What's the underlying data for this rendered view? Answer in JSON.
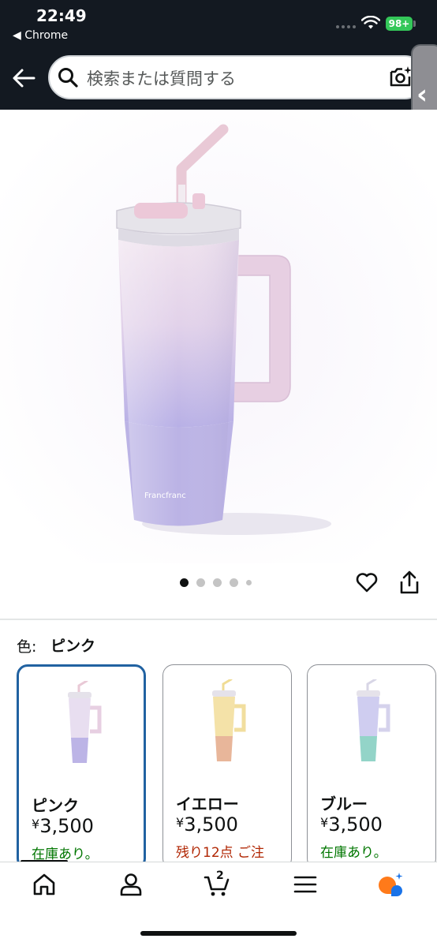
{
  "status_bar": {
    "time": "22:49",
    "back_app": "◀ Chrome",
    "battery": "98+"
  },
  "search": {
    "placeholder": "検索または質問する"
  },
  "product": {
    "brand_on_product": "Francfranc",
    "carousel": {
      "total": 5,
      "active_index": 0
    }
  },
  "variations": {
    "label": "色:",
    "selected": "ピンク",
    "options": [
      {
        "name": "ピンク",
        "currency": "¥",
        "price": "3,500",
        "stock": "在庫あり。",
        "stock_status": "in",
        "color": "#c9b8e8"
      },
      {
        "name": "イエロー",
        "currency": "¥",
        "price": "3,500",
        "stock": "残り12点 ご注",
        "stock_status": "low",
        "color": "#f1d79a"
      },
      {
        "name": "ブルー",
        "currency": "¥",
        "price": "3,500",
        "stock": "在庫あり。",
        "stock_status": "in",
        "color": "#9fd8cf"
      }
    ]
  },
  "bottom_nav": {
    "cart_count": "2",
    "items": [
      "home-icon",
      "account-icon",
      "cart-icon",
      "menu-icon",
      "rufus-icon"
    ]
  },
  "colors": {
    "header_bg": "#131921",
    "selected_border": "#2162a1",
    "in_stock": "#007600",
    "low_stock": "#b12704"
  }
}
